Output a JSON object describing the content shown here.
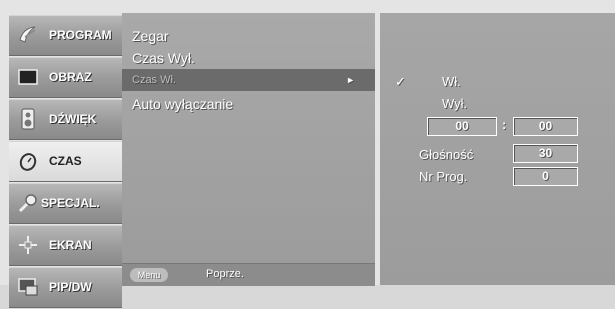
{
  "categories": [
    {
      "label": "PROGRAM",
      "icon": "satellite-dish-icon",
      "active": false
    },
    {
      "label": "OBRAZ",
      "icon": "monitor-icon",
      "active": false
    },
    {
      "label": "DŹWIĘK",
      "icon": "speaker-icon",
      "active": false
    },
    {
      "label": "CZAS",
      "icon": "clock-icon",
      "active": true
    },
    {
      "label": "SPECJAL.",
      "icon": "magnifier-icon",
      "active": false
    },
    {
      "label": "EKRAN",
      "icon": "crosshair-icon",
      "active": false
    },
    {
      "label": "PIP/DW",
      "icon": "picture-in-picture-icon",
      "active": false
    }
  ],
  "submenu": {
    "items": [
      "Zegar",
      "Czas Wył.",
      "Czas Wł.",
      "Auto wyłączanie"
    ],
    "selected_index": 2,
    "arrow": "►"
  },
  "footer": {
    "menu_key": "Menu",
    "label": "Poprze."
  },
  "options": {
    "check_mark": "✓",
    "on_label": "Wł.",
    "off_label": "Wył.",
    "hour": "00",
    "separator": ":",
    "minute": "00",
    "volume_label": "Głośność",
    "volume_value": "30",
    "program_label": "Nr Prog.",
    "program_value": "0"
  },
  "colors": {
    "selected_row": "#6b6b6b",
    "panel": "#a0a0a0",
    "text": "#ffffff"
  }
}
